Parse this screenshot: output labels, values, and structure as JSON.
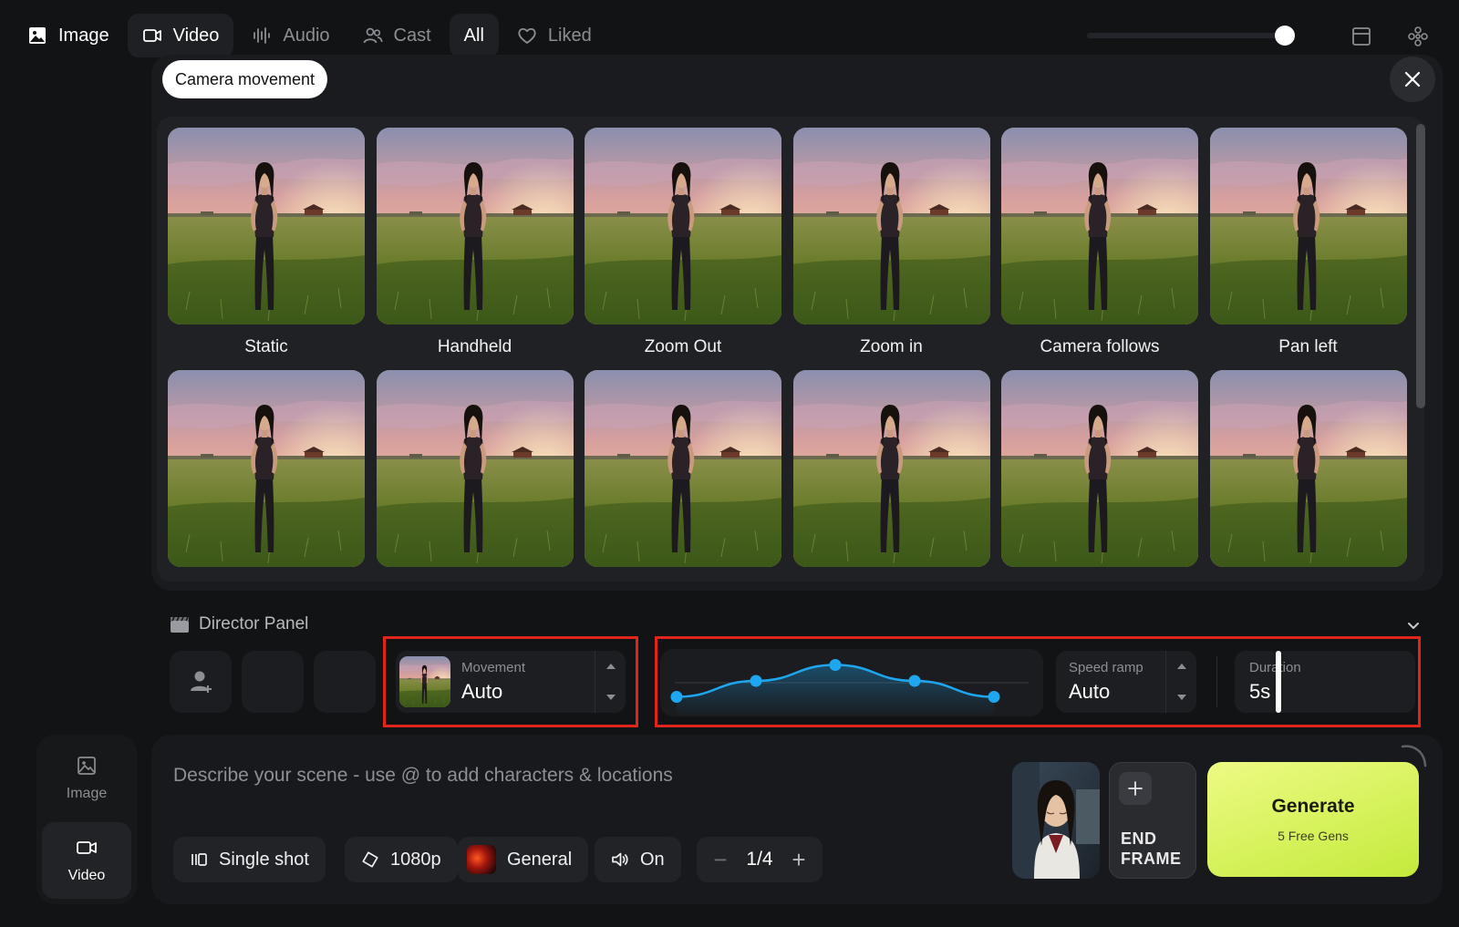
{
  "top_nav": {
    "tabs": [
      {
        "label": "Image",
        "icon": "image-icon"
      },
      {
        "label": "Video",
        "icon": "video-camera-icon"
      },
      {
        "label": "Audio",
        "icon": "waveform-icon"
      },
      {
        "label": "Cast",
        "icon": "people-icon"
      },
      {
        "label": "All",
        "icon": ""
      },
      {
        "label": "Liked",
        "icon": "heart-icon"
      }
    ],
    "active_tab": "Video",
    "zoom_level": 0.94,
    "right_icons": [
      "layout-icon",
      "grid-flower-icon"
    ]
  },
  "camera_movement": {
    "title": "Camera movement",
    "presets": [
      {
        "label": "Static"
      },
      {
        "label": "Handheld"
      },
      {
        "label": "Zoom Out"
      },
      {
        "label": "Zoom in"
      },
      {
        "label": "Camera follows"
      },
      {
        "label": "Pan left"
      },
      {
        "label": ""
      },
      {
        "label": ""
      },
      {
        "label": ""
      },
      {
        "label": ""
      },
      {
        "label": ""
      },
      {
        "label": ""
      }
    ]
  },
  "director_panel": {
    "title": "Director Panel",
    "movement": {
      "label": "Movement",
      "value": "Auto"
    },
    "speed_curve": [
      0.15,
      0.5,
      0.85,
      0.5,
      0.15
    ],
    "speed_ramp": {
      "label": "Speed ramp",
      "value": "Auto"
    },
    "duration": {
      "label": "Duration",
      "value": "5s"
    }
  },
  "sidebar": {
    "items": [
      {
        "label": "Image",
        "icon": "image-icon"
      },
      {
        "label": "Video",
        "icon": "video-camera-icon"
      }
    ]
  },
  "prompt": {
    "placeholder": "Describe your scene - use @ to add characters & locations",
    "chips": {
      "shot": "Single shot",
      "resolution": "1080p",
      "style": "General",
      "audio": "On"
    },
    "count": "1/4",
    "end_frame_label": "END FRAME",
    "generate": {
      "title": "Generate",
      "subtitle": "5 Free Gens"
    }
  },
  "colors": {
    "accent_green": "#d6f25c",
    "highlight_red": "#e2251b",
    "curve_blue": "#1ea7ef"
  }
}
